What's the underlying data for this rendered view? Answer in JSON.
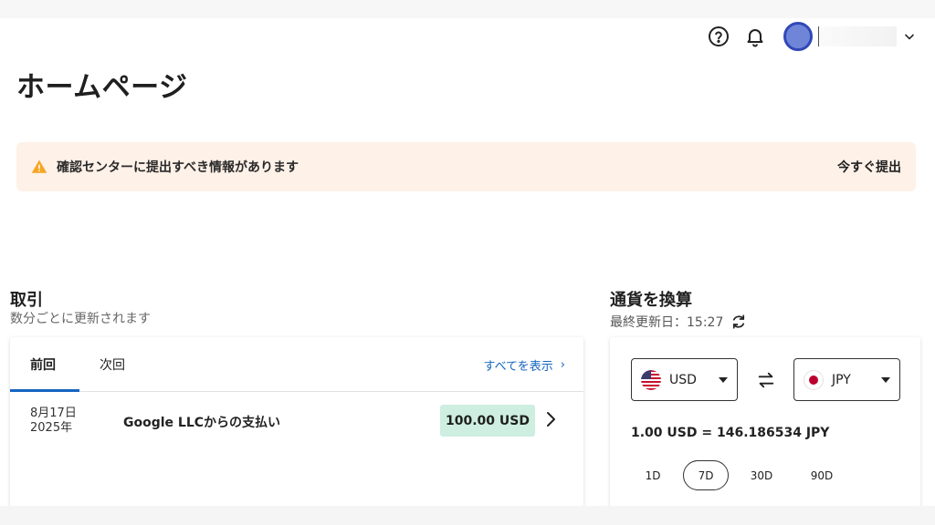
{
  "header": {
    "help_icon": "help-circle-icon",
    "bell_icon": "bell-icon",
    "avatar_color": "#6f86d8",
    "account_name": "|"
  },
  "page": {
    "title": "ホームページ"
  },
  "alert": {
    "icon": "warning-icon",
    "color": "#f5a623",
    "message": "確認センターに提出すべき情報があります",
    "action_label": "今すぐ提出"
  },
  "transactions": {
    "title": "取引",
    "subtitle": "数分ごとに更新されます",
    "tabs": [
      {
        "label": "前回",
        "active": true
      },
      {
        "label": "次回",
        "active": false
      }
    ],
    "view_all_label": "すべてを表示",
    "rows": [
      {
        "date_line1": "8月17日",
        "date_line2": "2025年",
        "description": "Google LLCからの支払い",
        "amount": "100.00 USD"
      }
    ]
  },
  "converter": {
    "title": "通貨を換算",
    "updated_label": "最終更新日：15:27",
    "from_currency": "USD",
    "to_currency": "JPY",
    "rate_text": "1.00 USD = 146.186534 JPY",
    "periods": [
      {
        "label": "1D",
        "active": false
      },
      {
        "label": "7D",
        "active": true
      },
      {
        "label": "30D",
        "active": false
      },
      {
        "label": "90D",
        "active": false
      }
    ]
  }
}
